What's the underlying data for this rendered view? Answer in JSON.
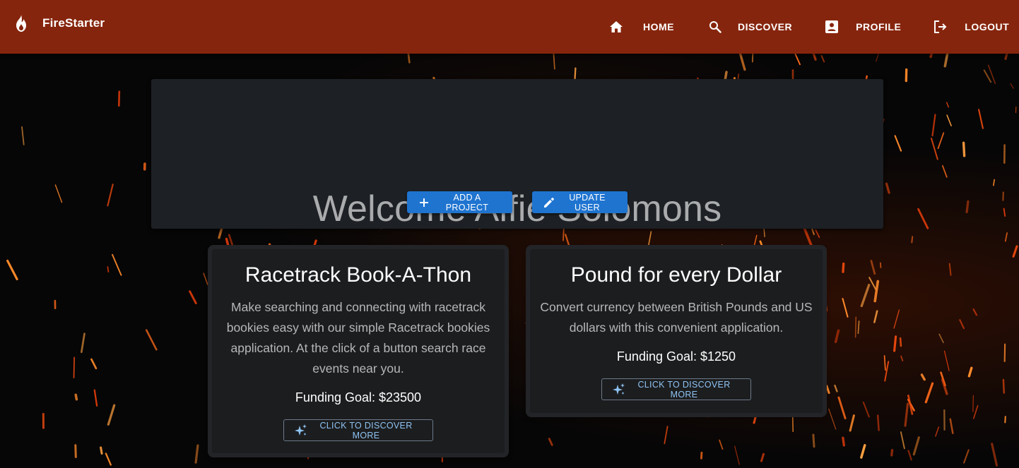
{
  "app": {
    "name": "FireStarter"
  },
  "nav": {
    "home": "HOME",
    "discover": "DISCOVER",
    "profile": "PROFILE",
    "logout": "LOGOUT"
  },
  "welcome": {
    "title": "Welcome Alfie Solomons",
    "add_project_label": "ADD A PROJECT",
    "update_user_label": "UPDATE USER"
  },
  "projects": [
    {
      "title": "Racetrack Book-A-Thon",
      "description": "Make searching and connecting with racetrack bookies easy with our simple Racetrack bookies application. At the click of a button search race events near you.",
      "funding_goal": "Funding Goal: $23500",
      "button_label": "CLICK TO DISCOVER MORE"
    },
    {
      "title": "Pound for every Dollar",
      "description": "Convert currency between British Pounds and US dollars with this convenient application.",
      "funding_goal": "Funding Goal: $1250",
      "button_label": "CLICK TO DISCOVER MORE"
    }
  ],
  "colors": {
    "appbar": "#86250d",
    "primary_button": "#1f74d0",
    "panel": "#1d2024",
    "outline_text": "#8ec3f2"
  },
  "icons": {
    "brand": "flame-icon",
    "home": "home-icon",
    "discover": "search-icon",
    "profile": "account-box-icon",
    "logout": "logout-icon",
    "add": "plus-icon",
    "edit": "pencil-icon",
    "discover_more": "sparkle-icon"
  }
}
